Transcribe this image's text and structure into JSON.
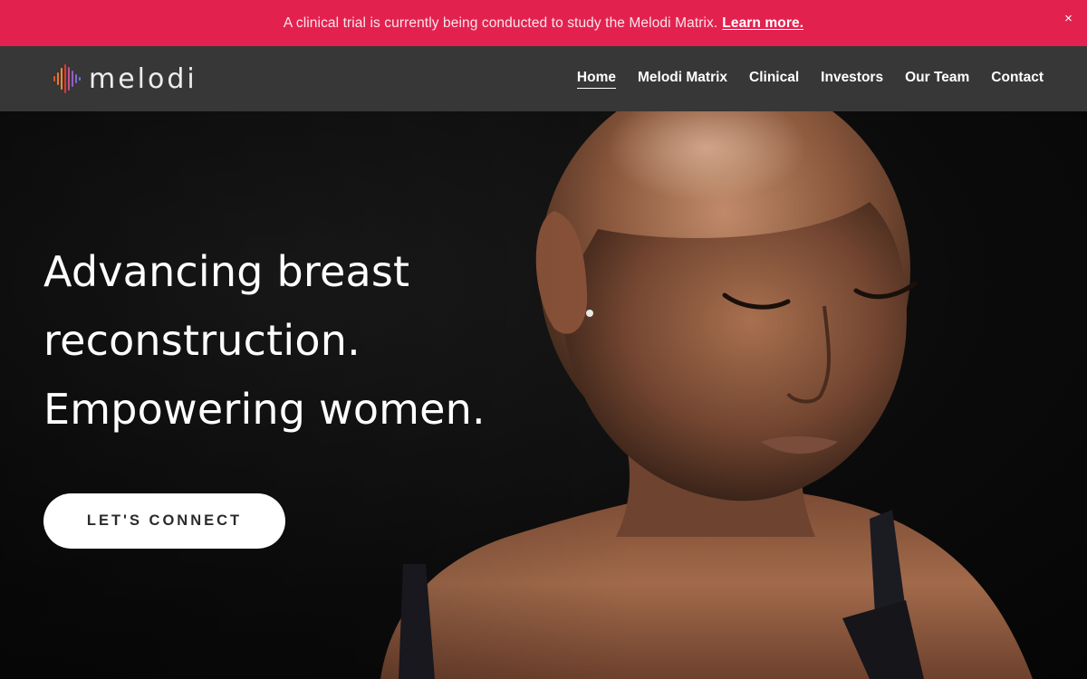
{
  "announcement": {
    "message": "A clinical trial is currently being conducted to study the Melodi Matrix.",
    "link_label": "Learn more.",
    "close_glyph": "×"
  },
  "header": {
    "logo_text": "melodi",
    "logo_icon": "sound-wave-logo-icon",
    "nav": [
      {
        "label": "Home",
        "active": true
      },
      {
        "label": "Melodi Matrix",
        "active": false
      },
      {
        "label": "Clinical",
        "active": false
      },
      {
        "label": "Investors",
        "active": false
      },
      {
        "label": "Our Team",
        "active": false
      },
      {
        "label": "Contact",
        "active": false
      }
    ]
  },
  "hero": {
    "headline_lines": [
      "Advancing breast",
      "reconstruction.",
      "Empowering women."
    ],
    "cta_label": "LET'S CONNECT"
  },
  "colors": {
    "announcement_bg": "#e3214f",
    "header_bg": "#373737",
    "hero_bg": "#0d0d0d",
    "cta_bg": "#ffffff",
    "cta_text": "#2b2b2b"
  }
}
